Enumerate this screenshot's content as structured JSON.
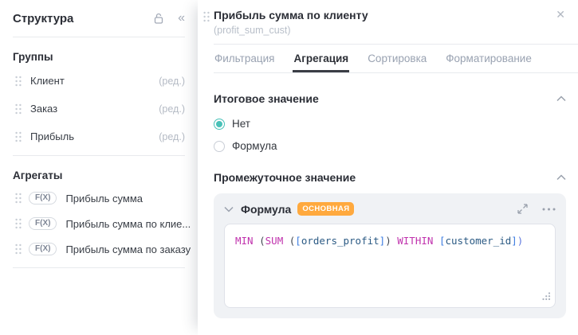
{
  "colors": {
    "accent": "#49c1b8",
    "badge": "#ffa93e",
    "tab-underline": "#3a3d45",
    "kw": "#c032ad",
    "paren": "#3f4650",
    "bracket": "#3c7ce0",
    "field": "#2b5a84",
    "paren-end": "#5e78de"
  },
  "sidebar": {
    "title": "Структура",
    "collapse_glyph": "«",
    "groups_heading": "Группы",
    "groups": [
      {
        "label": "Клиент",
        "edit": "(ред.)"
      },
      {
        "label": "Заказ",
        "edit": "(ред.)"
      },
      {
        "label": "Прибыль",
        "edit": "(ред.)"
      }
    ],
    "aggregates_heading": "Агрегаты",
    "aggregates": [
      {
        "badge": "F(X)",
        "label": "Прибыль сумма"
      },
      {
        "badge": "F(X)",
        "label": "Прибыль сумма по клие..."
      },
      {
        "badge": "F(X)",
        "label": "Прибыль сумма по заказу"
      }
    ]
  },
  "panel": {
    "title": "Прибыль сумма по клиенту",
    "subtitle": "(profit_sum_cust)",
    "close_glyph": "✕",
    "tabs": [
      {
        "label": "Фильтрация",
        "active": false
      },
      {
        "label": "Агрегация",
        "active": true
      },
      {
        "label": "Сортировка",
        "active": false
      },
      {
        "label": "Форматирование",
        "active": false
      }
    ],
    "total_section": {
      "heading": "Итоговое значение",
      "options": [
        {
          "label": "Нет",
          "selected": true
        },
        {
          "label": "Формула",
          "selected": false
        }
      ]
    },
    "intermediate_section": {
      "heading": "Промежуточное значение",
      "card": {
        "title": "Формула",
        "badge": "ОСНОВНАЯ",
        "formula_text": "MIN (SUM ([orders_profit]) WITHIN [customer_id])",
        "formula_tokens": [
          {
            "t": "MIN"
          },
          {
            "t": " ("
          },
          {
            "t": "SUM"
          },
          {
            "t": " ("
          },
          {
            "t": "["
          },
          {
            "t": "orders_profit"
          },
          {
            "t": "]"
          },
          {
            "t": ")"
          },
          {
            "t": " WITHIN "
          },
          {
            "t": "["
          },
          {
            "t": "customer_id"
          },
          {
            "t": "]"
          },
          {
            "t": ")"
          }
        ]
      }
    }
  }
}
